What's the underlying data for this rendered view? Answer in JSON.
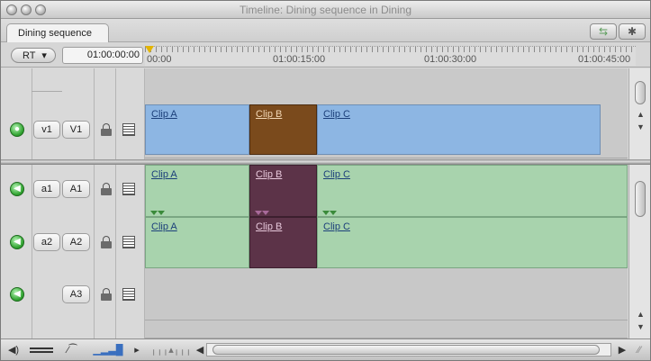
{
  "window": {
    "title": "Timeline: Dining sequence in Dining"
  },
  "tab": {
    "label": "Dining sequence"
  },
  "toolbar": {
    "rt_label": "RT",
    "rt_arrow": "▾",
    "timecode": "01:00:00:00",
    "snapping_icon": "snapping-icon",
    "linking_icon": "linking-icon"
  },
  "ruler": {
    "labels": [
      "00:00",
      "01:00:15:00",
      "01:00:30:00",
      "01:00:45:00"
    ]
  },
  "tracks": [
    {
      "kind": "video",
      "source": "v1",
      "dest": "V1",
      "clips": [
        {
          "label": "Clip A",
          "selected": false
        },
        {
          "label": "Clip B",
          "selected": true
        },
        {
          "label": "Clip C",
          "selected": false
        }
      ]
    },
    {
      "kind": "audio",
      "source": "a1",
      "dest": "A1",
      "clips": [
        {
          "label": "Clip A",
          "selected": false
        },
        {
          "label": "Clip B",
          "selected": true
        },
        {
          "label": "Clip C",
          "selected": false
        }
      ]
    },
    {
      "kind": "audio",
      "source": "a2",
      "dest": "A2",
      "clips": [
        {
          "label": "Clip A",
          "selected": false
        },
        {
          "label": "Clip B",
          "selected": true
        },
        {
          "label": "Clip C",
          "selected": false
        }
      ]
    },
    {
      "kind": "audio",
      "source": "",
      "dest": "A3",
      "clips": []
    }
  ],
  "colors": {
    "video_clip": "#8db6e3",
    "video_clip_selected": "#7a4a1c",
    "audio_clip": "#a8d3ad",
    "audio_clip_selected": "#5c3348",
    "track_on": "#33a533"
  }
}
